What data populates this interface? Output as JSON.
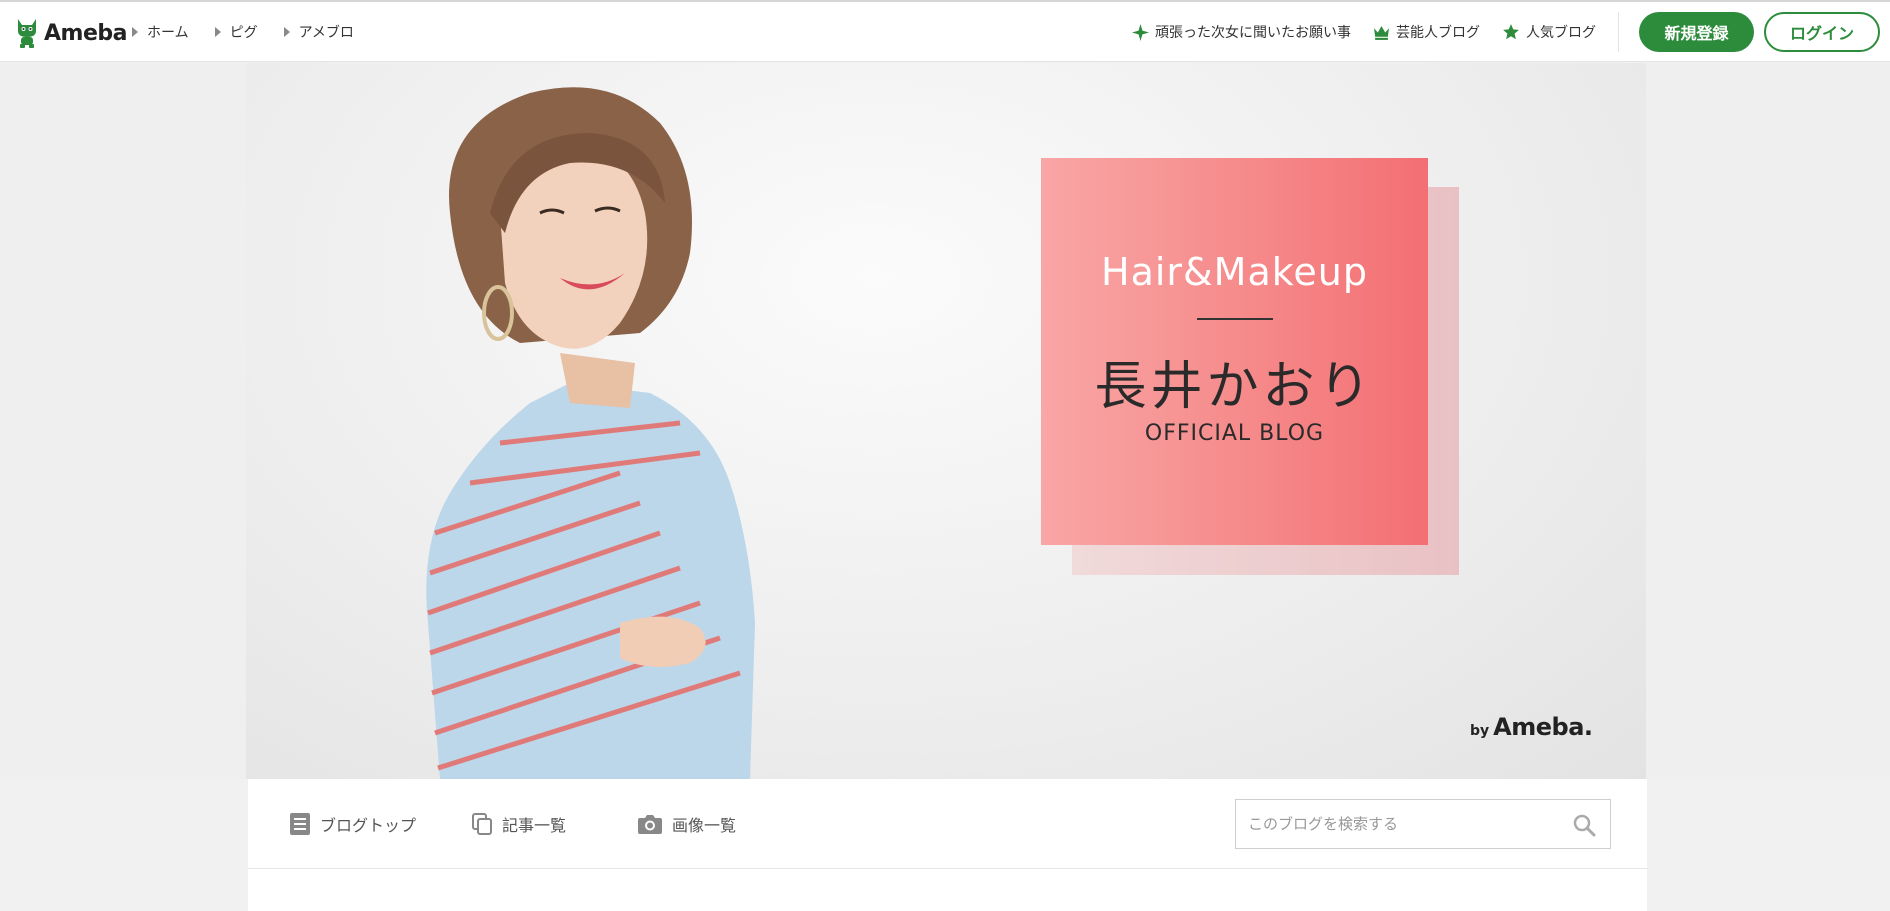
{
  "header": {
    "logo_text": "Ameba",
    "nav_left": [
      {
        "label": "ホーム"
      },
      {
        "label": "ピグ"
      },
      {
        "label": "アメブロ"
      }
    ],
    "nav_right": [
      {
        "label": "頑張った次女に聞いたお願い事",
        "icon": "sparkle-icon"
      },
      {
        "label": "芸能人ブログ",
        "icon": "crown-icon"
      },
      {
        "label": "人気ブログ",
        "icon": "star-icon"
      }
    ],
    "signup_label": "新規登録",
    "login_label": "ログイン"
  },
  "hero": {
    "card_title": "Hair&Makeup",
    "card_name": "長井かおり",
    "card_sub": "OFFICIAL BLOG",
    "by_label": "by",
    "by_brand": "Ameba."
  },
  "blog_nav": {
    "items": [
      {
        "label": "ブログトップ",
        "icon": "document-icon"
      },
      {
        "label": "記事一覧",
        "icon": "copy-icon"
      },
      {
        "label": "画像一覧",
        "icon": "camera-icon"
      }
    ],
    "search_placeholder": "このブログを検索する"
  },
  "colors": {
    "brand_green": "#2d8c3c",
    "card_pink": "#f68c8c"
  }
}
